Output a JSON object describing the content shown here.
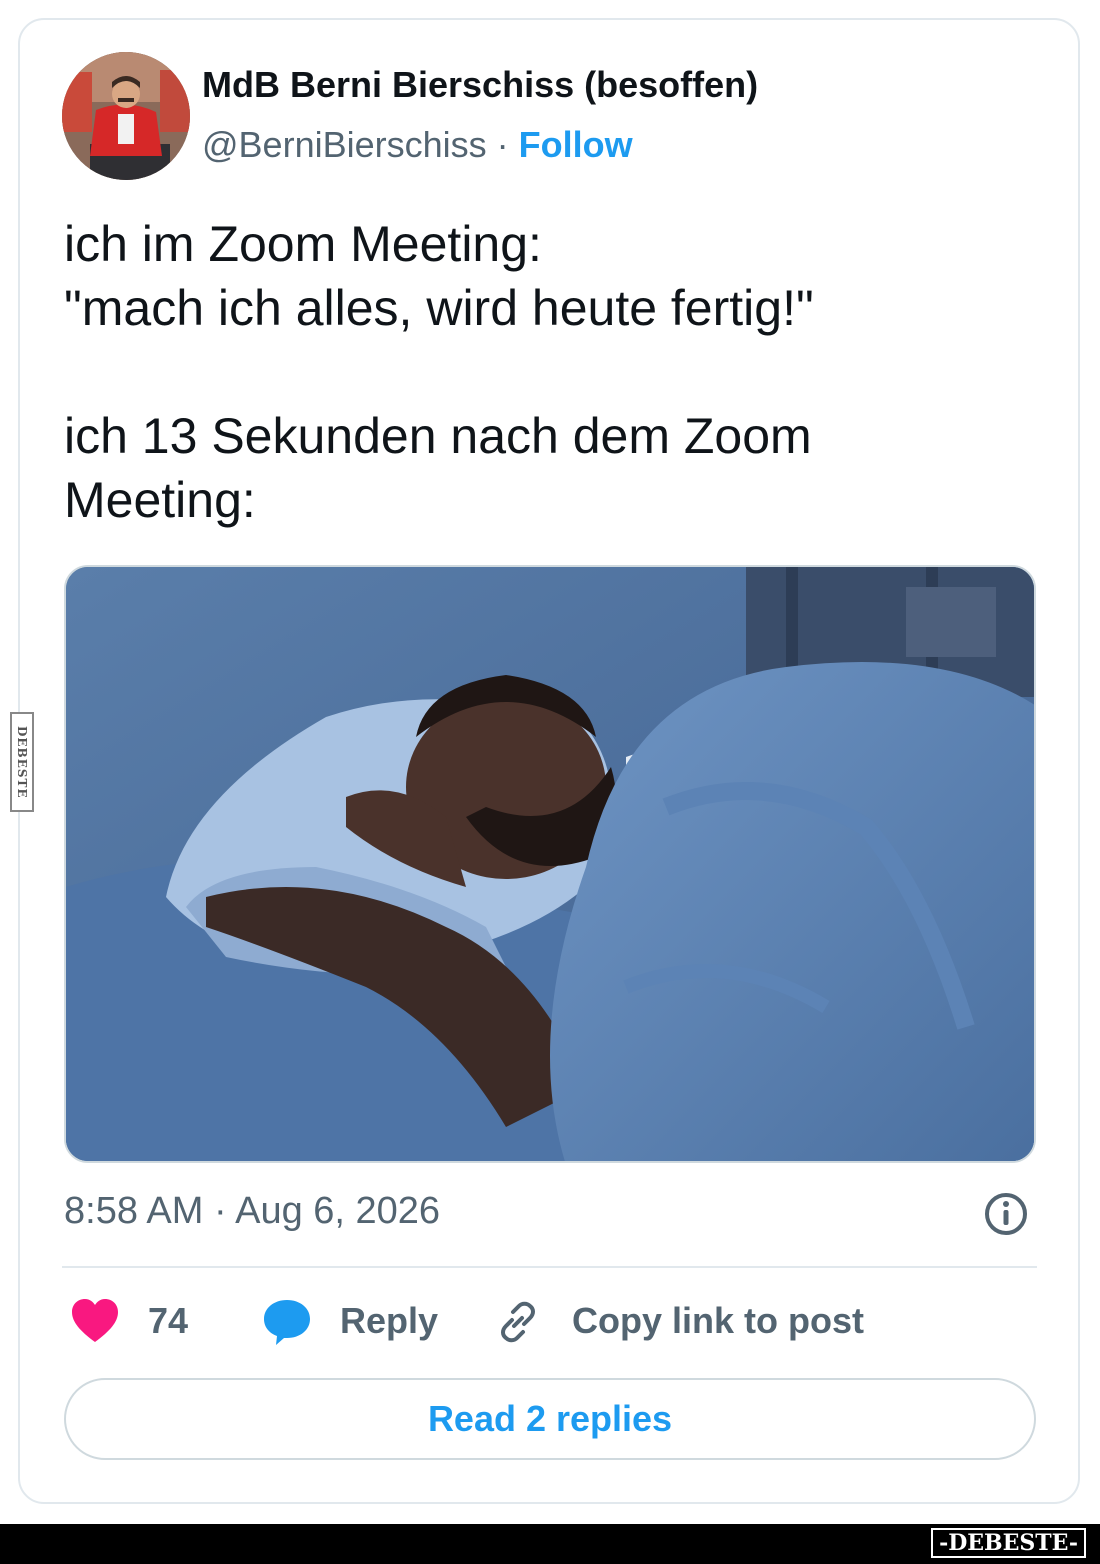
{
  "author": {
    "name": "MdB Berni Bierschiss (besoffen)",
    "handle": "@BerniBierschiss",
    "separator": " · ",
    "follow_label": "Follow"
  },
  "tweet": {
    "line1": "ich im Zoom Meeting:",
    "line2": "\"mach ich alles, wird heute fertig!\"",
    "line3": "ich 13 Sekunden nach dem Zoom",
    "line4": "Meeting:",
    "timestamp": "8:58 AM · Aug 6, 2026"
  },
  "actions": {
    "likes_count": "74",
    "reply_label": "Reply",
    "copy_link_label": "Copy link to post"
  },
  "read_replies_label": "Read 2 replies",
  "watermark": {
    "side_text": "DEBESTE",
    "footer_text": "-DEBESTE-"
  },
  "colors": {
    "accent": "#1d9bf0",
    "like": "#f91880",
    "muted": "#536471",
    "text": "#0f1419",
    "border": "#cfd9de"
  },
  "icons": {
    "like": "heart-icon",
    "reply": "speech-bubble-icon",
    "copy_link": "link-icon",
    "info": "info-icon"
  }
}
